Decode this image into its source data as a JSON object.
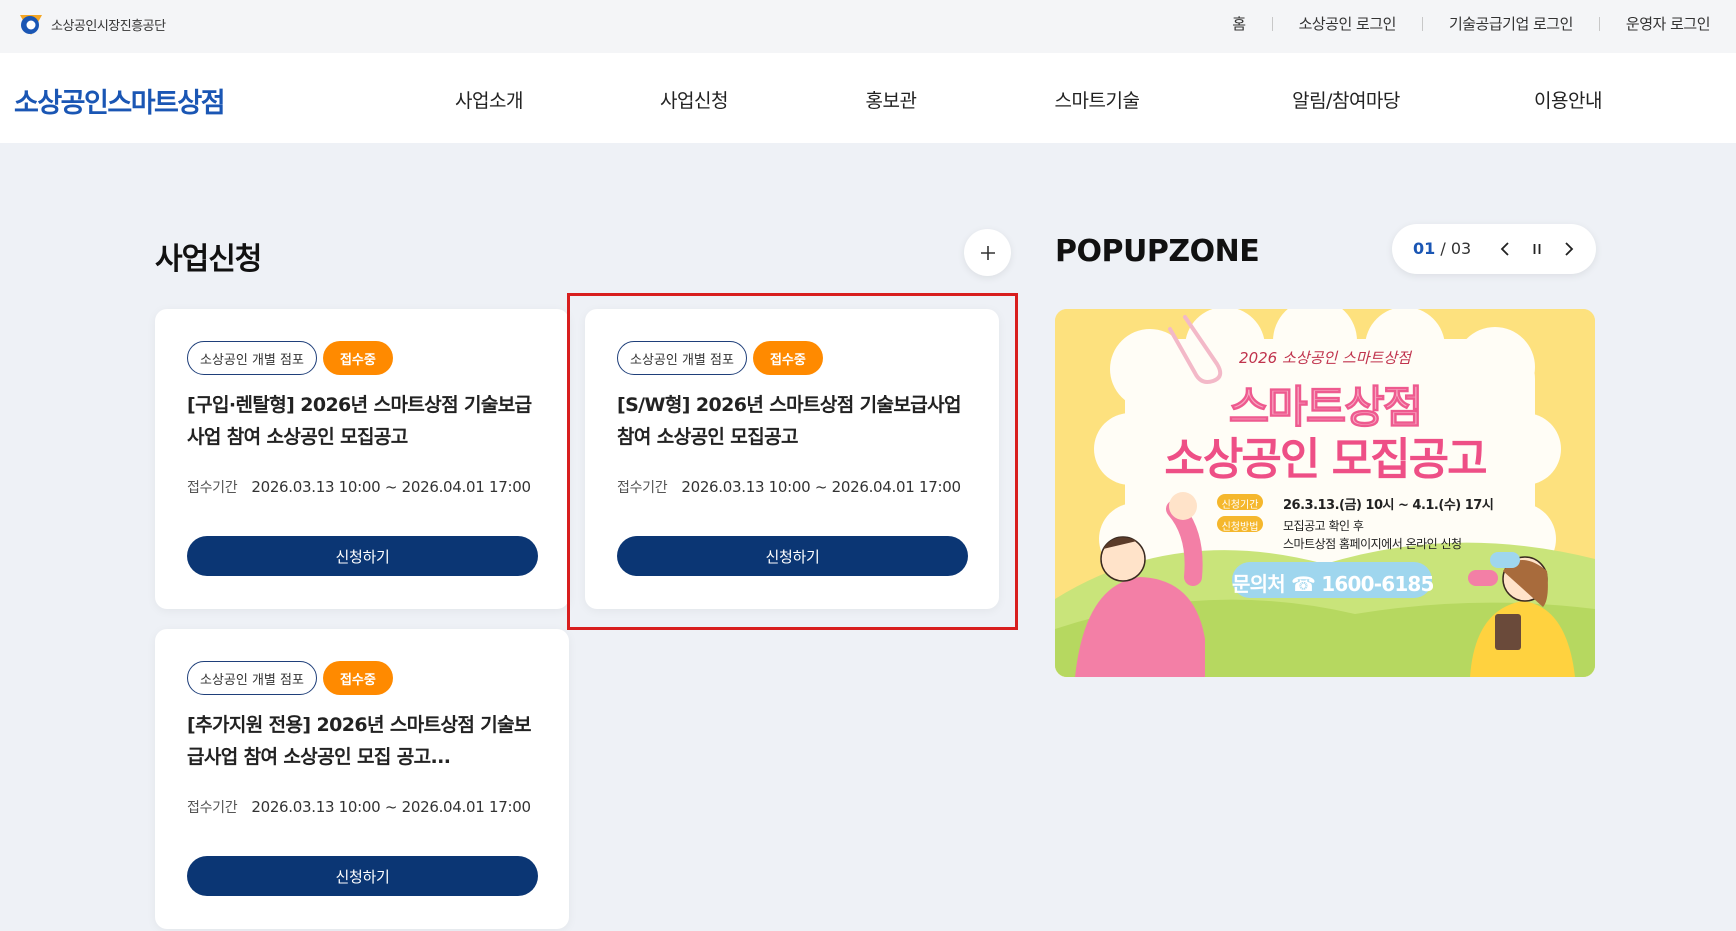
{
  "utility": {
    "org_name": "소상공인시장진흥공단",
    "links": [
      "홈",
      "소상공인 로그인",
      "기술공급기업 로그인",
      "운영자 로그인"
    ]
  },
  "nav": {
    "brand": "소상공인스마트상점",
    "items": [
      "사업소개",
      "사업신청",
      "홍보관",
      "스마트기술",
      "알림/참여마당",
      "이용안내"
    ]
  },
  "business": {
    "title": "사업신청",
    "cards": [
      {
        "tag": "소상공인 개별 점포",
        "status": "접수중",
        "title": "[구입·렌탈형] 2026년 스마트상점 기술보급사업 참여 소상공인 모집공고",
        "period_label": "접수기간",
        "period": "2026.03.13 10:00 ~ 2026.04.01 17:00",
        "button": "신청하기"
      },
      {
        "tag": "소상공인 개별 점포",
        "status": "접수중",
        "title": "[S/W형] 2026년 스마트상점 기술보급사업 참여 소상공인 모집공고",
        "period_label": "접수기간",
        "period": "2026.03.13 10:00 ~ 2026.04.01 17:00",
        "button": "신청하기"
      },
      {
        "tag": "소상공인 개별 점포",
        "status": "접수중",
        "title": "[추가지원 전용] 2026년 스마트상점 기술보급사업 참여 소상공인 모집 공고...",
        "period_label": "접수기간",
        "period": "2026.03.13 10:00 ~ 2026.04.01 17:00",
        "button": "신청하기"
      }
    ]
  },
  "popup": {
    "title": "POPUPZONE",
    "current": "01",
    "total": "03",
    "banner": {
      "kicker": "2026 소상공인 스마트상점",
      "headline1": "스마트상점",
      "headline2": "소상공인 모집공고",
      "apply_period_label": "신청기간",
      "apply_period": "26.3.13.(금) 10시 ~ 4.1.(수) 17시",
      "apply_method_label": "신청방법",
      "apply_method_line1": "모집공고 확인 후",
      "apply_method_line2": "스마트상점 홈페이지에서 온라인 신청",
      "contact": "문의처 ☎ 1600-6185"
    }
  },
  "colors": {
    "brand_blue": "#1a56b4",
    "button_navy": "#0b3674",
    "status_orange": "#ff8a00",
    "highlight_red": "#d81e1e",
    "banner_pink": "#f0508a"
  }
}
